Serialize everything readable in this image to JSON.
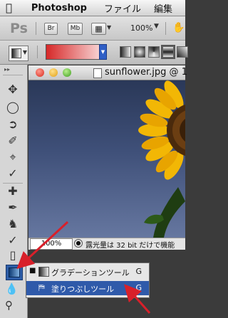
{
  "menubar": {
    "app_name": "Photoshop",
    "menus": [
      "ファイル",
      "編集"
    ]
  },
  "app_bar": {
    "logo": "Ps",
    "bridge_button": "Br",
    "minibridge_button": "Mb",
    "zoom": "100%"
  },
  "options_bar": {
    "gradient_colors": [
      "#d62828",
      "#f7d0d0"
    ]
  },
  "document": {
    "title": "sunflower.jpg @ 1",
    "status_zoom": "100%",
    "status_text": "露光量は 32 bit だけで機能"
  },
  "flyout": {
    "items": [
      {
        "label": "グラデーションツール",
        "shortcut": "G",
        "selected": true
      },
      {
        "label": "塗りつぶしツール",
        "shortcut": "G",
        "selected": false
      }
    ]
  },
  "colors": {
    "highlight": "#2f5aaa",
    "annotation_arrow": "#d8202a"
  }
}
